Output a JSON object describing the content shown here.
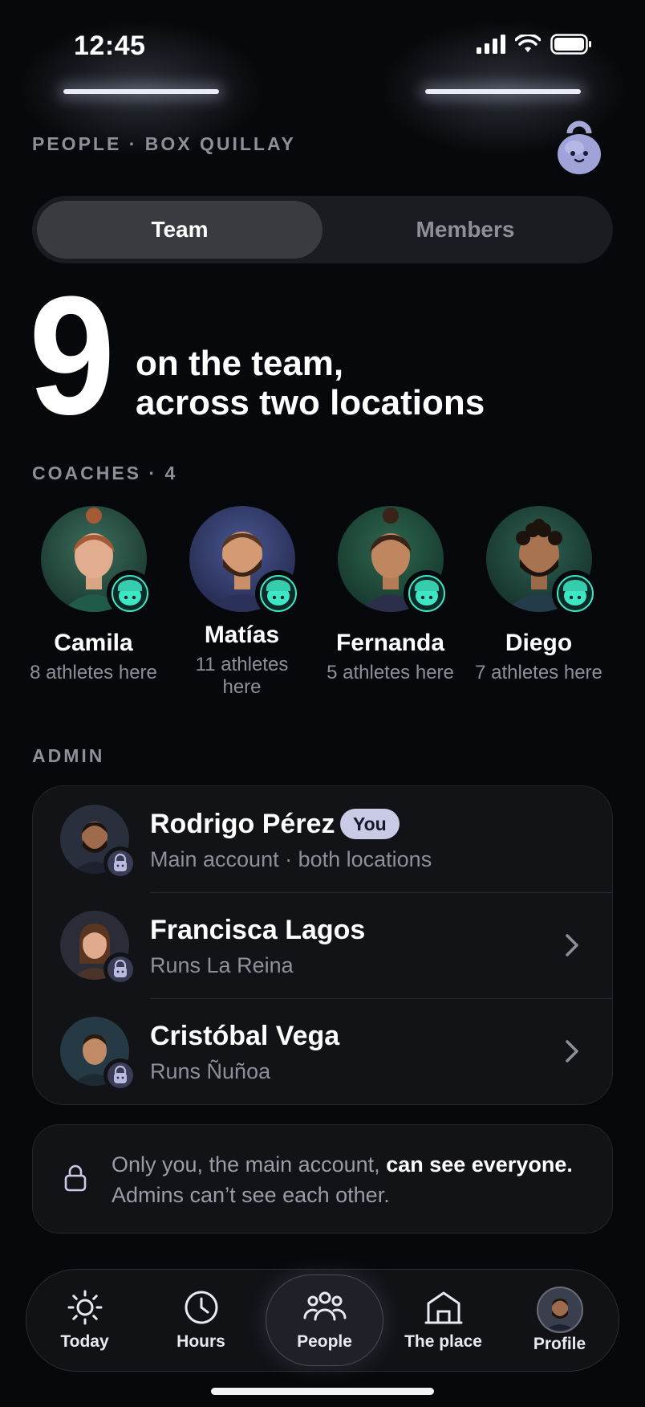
{
  "status_bar": {
    "time": "12:45"
  },
  "header": {
    "section": "PEOPLE · BOX QUILLAY"
  },
  "tabs": {
    "active": "Team",
    "inactive": "Members"
  },
  "summary": {
    "count": "9",
    "line1": "on the team,",
    "line2": "across two locations"
  },
  "coaches": {
    "label": "COACHES · 4",
    "items": [
      {
        "name": "Camila",
        "sub": "8 athletes here"
      },
      {
        "name": "Matías",
        "sub": "11 athletes here"
      },
      {
        "name": "Fernanda",
        "sub": "5 athletes here"
      },
      {
        "name": "Diego",
        "sub": "7 athletes here"
      }
    ]
  },
  "admin": {
    "label": "ADMIN",
    "you_badge": "You",
    "items": [
      {
        "name": "Rodrigo Pérez",
        "sub": "Main account · both locations"
      },
      {
        "name": "Francisca Lagos",
        "sub": "Runs La Reina"
      },
      {
        "name": "Cristóbal Vega",
        "sub": "Runs Ñuñoa"
      }
    ]
  },
  "note": {
    "part1": "Only you, the main account, ",
    "bold": "can see everyone.",
    "part2": "Admins can’t see each other."
  },
  "nav": {
    "today": "Today",
    "hours": "Hours",
    "people": "People",
    "place": "The place",
    "profile": "Profile"
  },
  "colors": {
    "accent_teal": "#3ee6c4",
    "background": "#07080b",
    "pill": "#c9cbe6"
  }
}
